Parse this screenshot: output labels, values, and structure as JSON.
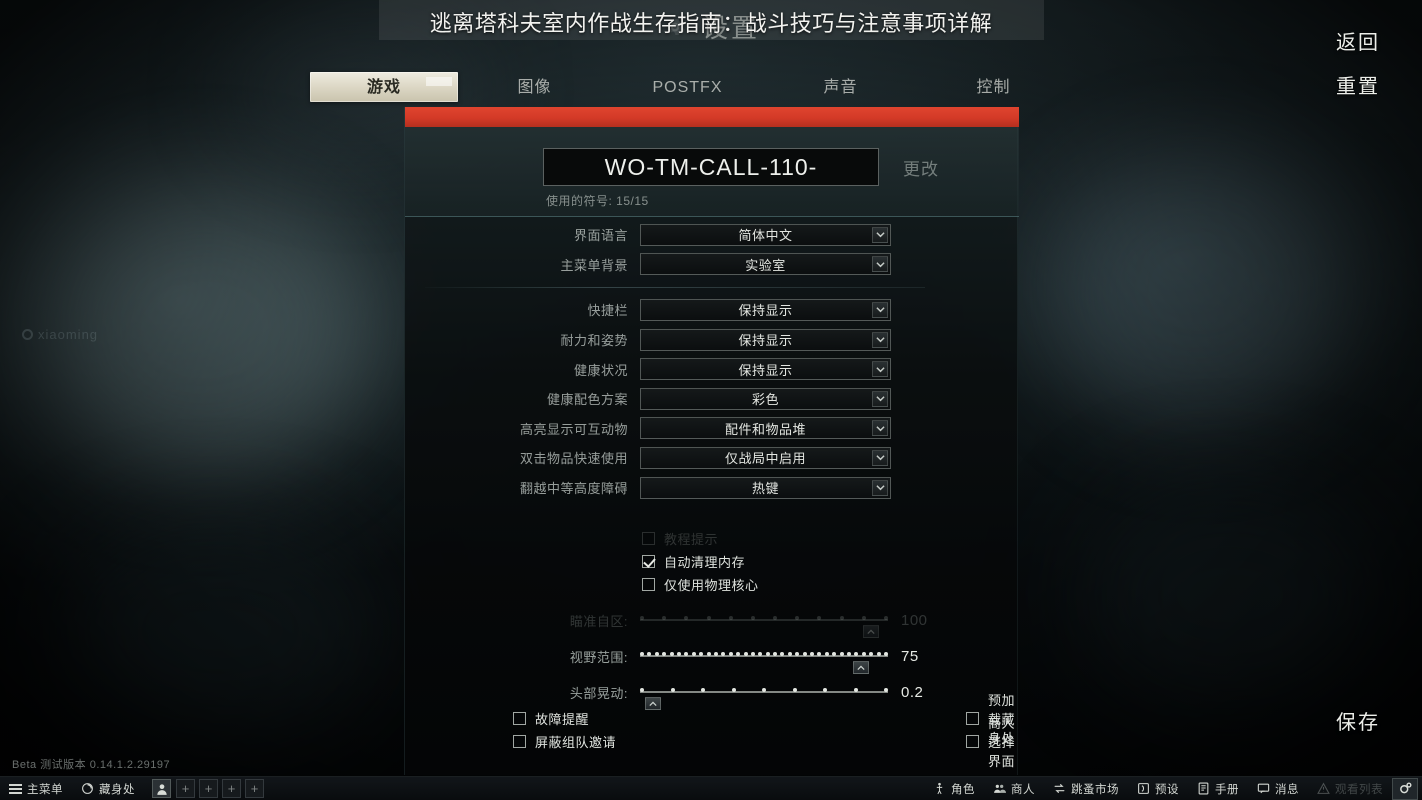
{
  "overlay_title": "逃离塔科夫室内作战生存指南：战斗技巧与注意事项详解",
  "settings_heading": "设置",
  "tabs": [
    {
      "label": "游戏",
      "active": true
    },
    {
      "label": "图像",
      "active": false
    },
    {
      "label": "POSTFX",
      "active": false
    },
    {
      "label": "声音",
      "active": false
    },
    {
      "label": "控制",
      "active": false
    }
  ],
  "nickname": {
    "value": "WO-TM-CALL-110-",
    "placeholder": "WO-TM-CALL-110-",
    "change_label": "更改",
    "symbols_used": "使用的符号: 15/15"
  },
  "rows_group_a": [
    {
      "label": "界面语言",
      "value": "简体中文",
      "dim": false
    },
    {
      "label": "主菜单背景",
      "value": "实验室",
      "dim": false
    }
  ],
  "rows_group_b": [
    {
      "label": "快捷栏",
      "value": "保持显示",
      "dim": false
    },
    {
      "label": "耐力和姿势",
      "value": "保持显示",
      "dim": false
    },
    {
      "label": "健康状况",
      "value": "保持显示",
      "dim": false
    },
    {
      "label": "健康配色方案",
      "value": "彩色",
      "dim": false
    },
    {
      "label": "高亮显示可互动物",
      "value": "配件和物品堆",
      "dim": false
    },
    {
      "label": "双击物品快速使用",
      "value": "仅战局中启用",
      "dim": false
    },
    {
      "label": "翻越中等高度障碍",
      "value": "热键",
      "dim": false
    }
  ],
  "checkboxes": [
    {
      "label": "教程提示",
      "checked": false,
      "dim": true
    },
    {
      "label": "自动清理内存",
      "checked": true,
      "dim": false
    },
    {
      "label": "仅使用物理核心",
      "checked": false,
      "dim": false
    }
  ],
  "sliders": [
    {
      "label": "瞄准自区:",
      "value": "100",
      "percent": 96,
      "ticks": 12,
      "dim": true
    },
    {
      "label": "视野范围:",
      "value": "75",
      "percent": 92,
      "ticks": 34,
      "dim": false
    },
    {
      "label": "头部晃动:",
      "value": "0.2",
      "percent": 2,
      "ticks": 9,
      "dim": false
    }
  ],
  "bottom_checks_left": [
    {
      "label": "故障提醒",
      "checked": false
    },
    {
      "label": "屏蔽组队邀请",
      "checked": false
    }
  ],
  "bottom_checks_right": [
    {
      "label": "预加载藏身处",
      "checked": false
    },
    {
      "label": "商人选择界面",
      "checked": false
    }
  ],
  "side_buttons": {
    "back": "返回",
    "reset": "重置",
    "save": "保存"
  },
  "beta_version": "Beta 测试版本 0.14.1.2.29197",
  "taskbar_left": [
    {
      "label": "主菜单",
      "icon": "hamburger-icon"
    },
    {
      "label": "藏身处",
      "icon": "hideout-icon"
    }
  ],
  "taskbar_slots": [
    "+",
    "+",
    "+",
    "+"
  ],
  "taskbar_right": [
    {
      "label": "角色",
      "icon": "character-icon",
      "dim": false
    },
    {
      "label": "商人",
      "icon": "traders-icon",
      "dim": false
    },
    {
      "label": "跳蚤市场",
      "icon": "flea-market-icon",
      "dim": false
    },
    {
      "label": "预设",
      "icon": "presets-icon",
      "dim": false
    },
    {
      "label": "手册",
      "icon": "handbook-icon",
      "dim": false
    },
    {
      "label": "消息",
      "icon": "messages-icon",
      "dim": false
    },
    {
      "label": "观看列表",
      "icon": "watchlist-icon",
      "dim": true
    }
  ],
  "watermark": "xiaoming",
  "colors": {
    "accent_red": "#d33a27",
    "active_tab": "#ddd8c6",
    "panel_bg": "#0a0e0f",
    "text": "#e3e6e1"
  }
}
